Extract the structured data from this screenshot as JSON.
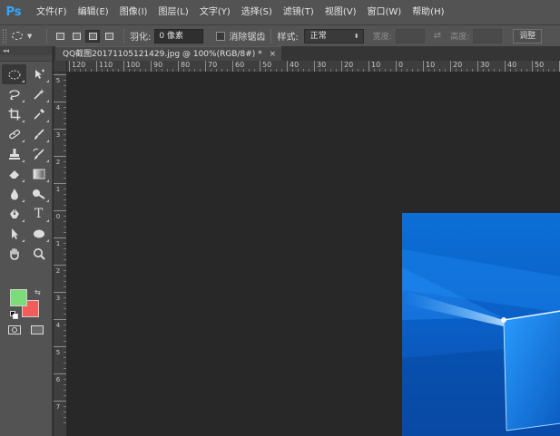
{
  "app": {
    "logo": "Ps"
  },
  "menu": [
    "文件(F)",
    "编辑(E)",
    "图像(I)",
    "图层(L)",
    "文字(Y)",
    "选择(S)",
    "滤镜(T)",
    "视图(V)",
    "窗口(W)",
    "帮助(H)"
  ],
  "options": {
    "feather_label": "羽化:",
    "feather_value": "0 像素",
    "antialias_label": "消除锯齿",
    "style_label": "样式:",
    "style_value": "正常",
    "width_label": "宽度:",
    "height_label": "高度:",
    "adjust_label": "调整"
  },
  "document": {
    "tab_title": "QQ截图20171105121429.jpg @ 100%(RGB/8#) *",
    "close_glyph": "×"
  },
  "rulers": {
    "horizontal": [
      "120",
      "110",
      "100",
      "90",
      "80",
      "70",
      "60",
      "50",
      "40",
      "30",
      "20",
      "10",
      "0",
      "10",
      "20",
      "30",
      "40",
      "50",
      "60"
    ],
    "vertical": [
      "5",
      "4",
      "3",
      "2",
      "1",
      "0",
      "1",
      "2",
      "3",
      "4",
      "5",
      "6",
      "7"
    ]
  },
  "colors": {
    "foreground": "#7ddc7a",
    "background": "#f25c5a",
    "accent": "#31a8ff",
    "image_blue": "#0a63c8"
  },
  "tools": [
    {
      "icon": "elliptical-marquee-icon",
      "selected": true
    },
    {
      "icon": "move-icon"
    },
    {
      "icon": "lasso-icon"
    },
    {
      "icon": "magic-wand-icon"
    },
    {
      "icon": "crop-icon"
    },
    {
      "icon": "eyedropper-icon"
    },
    {
      "icon": "spot-healing-icon"
    },
    {
      "icon": "brush-icon"
    },
    {
      "icon": "clone-stamp-icon"
    },
    {
      "icon": "history-brush-icon"
    },
    {
      "icon": "eraser-icon"
    },
    {
      "icon": "gradient-icon"
    },
    {
      "icon": "blur-icon"
    },
    {
      "icon": "dodge-icon"
    },
    {
      "icon": "pen-icon"
    },
    {
      "icon": "type-icon"
    },
    {
      "icon": "path-selection-icon"
    },
    {
      "icon": "ellipse-shape-icon"
    },
    {
      "icon": "hand-icon"
    },
    {
      "icon": "zoom-icon"
    }
  ]
}
